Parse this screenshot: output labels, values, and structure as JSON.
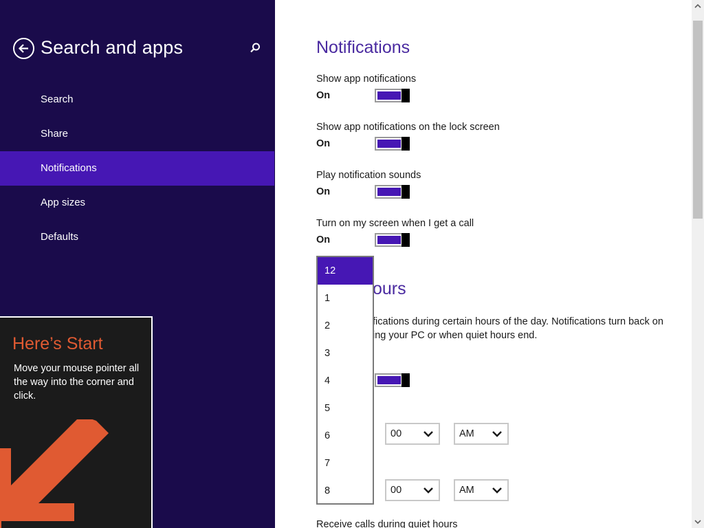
{
  "left_pane": {
    "title": "Search and apps",
    "back_icon": "back-arrow-circle-icon",
    "search_icon": "magnifier-icon",
    "nav_items": [
      {
        "label": "Search",
        "selected": false
      },
      {
        "label": "Share",
        "selected": false
      },
      {
        "label": "Notifications",
        "selected": true
      },
      {
        "label": "App sizes",
        "selected": false
      },
      {
        "label": "Defaults",
        "selected": false
      }
    ],
    "colors": {
      "background": "#1a0b4b",
      "selected": "#4617b4"
    }
  },
  "start_tip": {
    "title": "Here’s Start",
    "body": "Move your mouse pointer all the way into the corner and click.",
    "arrow_color": "#e05a32"
  },
  "notifications": {
    "heading": "Notifications",
    "settings": [
      {
        "label": "Show app notifications",
        "state": "On"
      },
      {
        "label": "Show app notifications on the lock screen",
        "state": "On"
      },
      {
        "label": "Play notification sounds",
        "state": "On"
      },
      {
        "label": "Turn on my screen when I get a call",
        "state": "On"
      }
    ]
  },
  "quiet_hours": {
    "heading_partial": "ours",
    "description_line1": "fications during certain hours of the day. Notifications turn back on",
    "description_line2": "ing your PC or when quiet hours end.",
    "from": {
      "minute": "00",
      "ampm": "AM"
    },
    "to": {
      "minute": "00",
      "ampm": "AM"
    },
    "receive_calls_label": "Receive calls during quiet hours"
  },
  "hour_dropdown": {
    "options": [
      "12",
      "1",
      "2",
      "3",
      "4",
      "5",
      "6",
      "7",
      "8"
    ],
    "selected": "12"
  },
  "accent_color": "#4617b4"
}
